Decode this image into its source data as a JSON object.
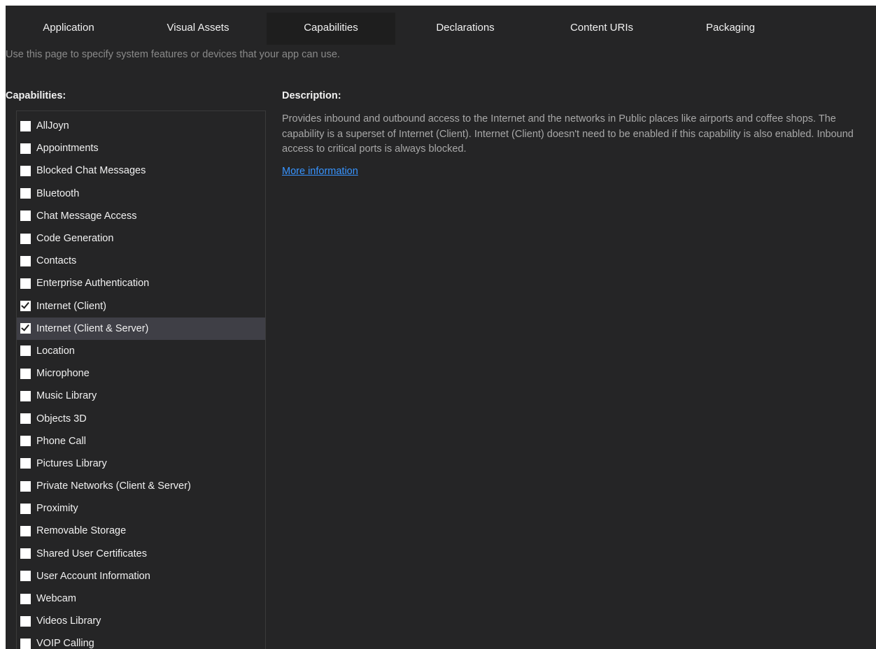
{
  "tabs": [
    {
      "label": "Application",
      "active": false
    },
    {
      "label": "Visual Assets",
      "active": false
    },
    {
      "label": "Capabilities",
      "active": true
    },
    {
      "label": "Declarations",
      "active": false
    },
    {
      "label": "Content URIs",
      "active": false
    },
    {
      "label": "Packaging",
      "active": false
    }
  ],
  "hint": "Use this page to specify system features or devices that your app can use.",
  "capabilities": {
    "heading": "Capabilities:",
    "items": [
      {
        "label": "AllJoyn",
        "checked": false,
        "selected": false
      },
      {
        "label": "Appointments",
        "checked": false,
        "selected": false
      },
      {
        "label": "Blocked Chat Messages",
        "checked": false,
        "selected": false
      },
      {
        "label": "Bluetooth",
        "checked": false,
        "selected": false
      },
      {
        "label": "Chat Message Access",
        "checked": false,
        "selected": false
      },
      {
        "label": "Code Generation",
        "checked": false,
        "selected": false
      },
      {
        "label": "Contacts",
        "checked": false,
        "selected": false
      },
      {
        "label": "Enterprise Authentication",
        "checked": false,
        "selected": false
      },
      {
        "label": "Internet (Client)",
        "checked": true,
        "selected": false
      },
      {
        "label": "Internet (Client & Server)",
        "checked": true,
        "selected": true
      },
      {
        "label": "Location",
        "checked": false,
        "selected": false
      },
      {
        "label": "Microphone",
        "checked": false,
        "selected": false
      },
      {
        "label": "Music Library",
        "checked": false,
        "selected": false
      },
      {
        "label": "Objects 3D",
        "checked": false,
        "selected": false
      },
      {
        "label": "Phone Call",
        "checked": false,
        "selected": false
      },
      {
        "label": "Pictures Library",
        "checked": false,
        "selected": false
      },
      {
        "label": "Private Networks (Client & Server)",
        "checked": false,
        "selected": false
      },
      {
        "label": "Proximity",
        "checked": false,
        "selected": false
      },
      {
        "label": "Removable Storage",
        "checked": false,
        "selected": false
      },
      {
        "label": "Shared User Certificates",
        "checked": false,
        "selected": false
      },
      {
        "label": "User Account Information",
        "checked": false,
        "selected": false
      },
      {
        "label": "Webcam",
        "checked": false,
        "selected": false
      },
      {
        "label": "Videos Library",
        "checked": false,
        "selected": false
      },
      {
        "label": "VOIP Calling",
        "checked": false,
        "selected": false
      }
    ]
  },
  "description": {
    "heading": "Description:",
    "text": "Provides inbound and outbound access to the Internet and the networks in Public places like airports and coffee shops. The capability is a superset of Internet (Client). Internet (Client) doesn't need to be enabled if this capability is also enabled. Inbound access to critical ports is always blocked.",
    "link": "More information"
  },
  "colors": {
    "background": "#252526",
    "active_tab": "#1e1e1e",
    "selected_row": "#3f3f46",
    "link": "#3794ff",
    "text": "#f1f1f1",
    "muted_text": "#a8a8a8"
  }
}
